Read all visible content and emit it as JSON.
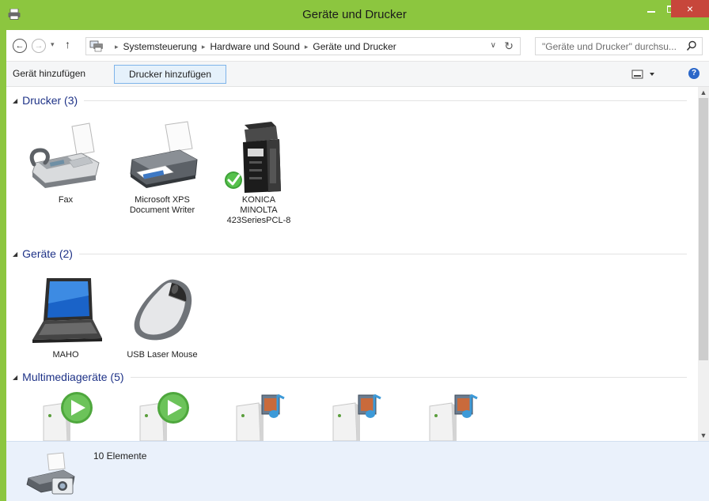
{
  "window": {
    "title": "Geräte und Drucker",
    "minimize_glyph": "–",
    "close_glyph": "×"
  },
  "navigation": {
    "back_glyph": "←",
    "forward_glyph": "→",
    "recent_glyph": "▾",
    "up_glyph": "↑",
    "breadcrumbs": [
      "Systemsteuerung",
      "Hardware und Sound",
      "Geräte und Drucker"
    ],
    "separator_glyph": "▸",
    "dropdown_glyph": "∨",
    "refresh_glyph": "↻",
    "search_placeholder": "\"Geräte und Drucker\" durchsu..."
  },
  "commands": {
    "add_device": "Gerät hinzufügen",
    "add_printer": "Drucker hinzufügen",
    "help_glyph": "?"
  },
  "groups": {
    "printers": {
      "label": "Drucker (3)",
      "items": [
        {
          "label": "Fax",
          "icon": "fax-icon"
        },
        {
          "label": "Microsoft XPS\nDocument Writer",
          "icon": "printer-icon"
        },
        {
          "label": "KONICA\nMINOLTA\n423SeriesPCL-8",
          "icon": "copier-icon",
          "default": true
        }
      ]
    },
    "devices": {
      "label": "Geräte (2)",
      "items": [
        {
          "label": "MAHO",
          "icon": "laptop-icon"
        },
        {
          "label": "USB Laser Mouse",
          "icon": "mouse-icon"
        }
      ]
    },
    "multimedia": {
      "label": "Multimediageräte (5)",
      "items": [
        {
          "icon": "media-player-icon"
        },
        {
          "icon": "media-player-icon"
        },
        {
          "icon": "media-server-icon"
        },
        {
          "icon": "media-server-icon"
        },
        {
          "icon": "media-server-icon"
        }
      ]
    }
  },
  "details": {
    "count_text": "10 Elemente"
  },
  "colors": {
    "title_bar": "#8cc63f",
    "close_button": "#c7463b",
    "group_header_text": "#1e3287",
    "details_pane": "#eaf1fb",
    "selected_command_border": "#7eb4ea"
  },
  "scroll": {
    "up_glyph": "▲",
    "down_glyph": "▼"
  },
  "group_toggle_glyph": "◢"
}
